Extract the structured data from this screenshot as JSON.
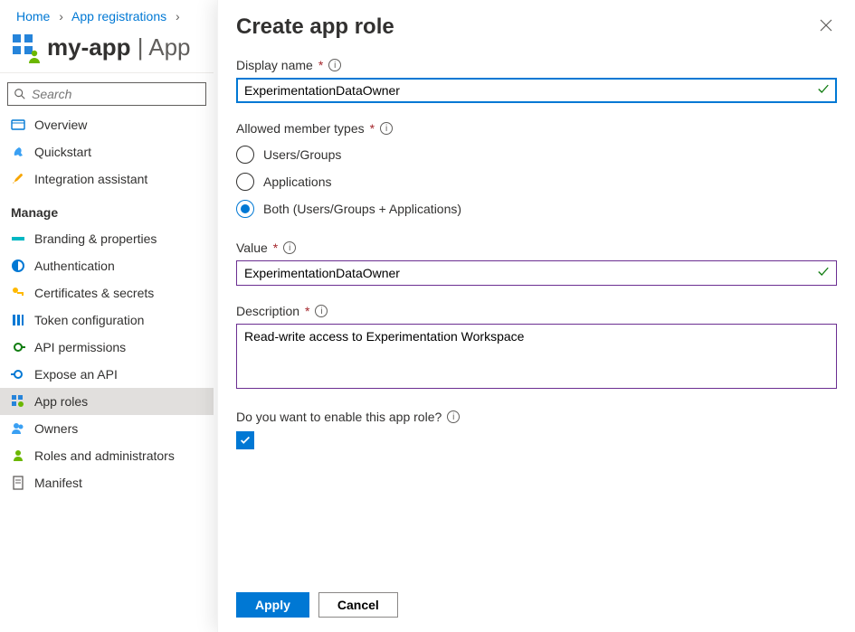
{
  "breadcrumb": {
    "home": "Home",
    "appreg": "App registrations"
  },
  "header": {
    "title_app": "my-app",
    "title_section": "App"
  },
  "search": {
    "placeholder": "Search"
  },
  "nav": {
    "overview": "Overview",
    "quickstart": "Quickstart",
    "integration": "Integration assistant",
    "group_manage": "Manage",
    "branding": "Branding & properties",
    "authn": "Authentication",
    "certs": "Certificates & secrets",
    "tokencfg": "Token configuration",
    "apiperm": "API permissions",
    "expose": "Expose an API",
    "approles": "App roles",
    "owners": "Owners",
    "rolesadmin": "Roles and administrators",
    "manifest": "Manifest"
  },
  "panel": {
    "title": "Create app role",
    "display_name_label": "Display name",
    "display_name_value": "ExperimentationDataOwner",
    "allowed_label": "Allowed member types",
    "allowed_options": {
      "users": "Users/Groups",
      "apps": "Applications",
      "both": "Both (Users/Groups + Applications)"
    },
    "allowed_selected": "both",
    "value_label": "Value",
    "value_value": "ExperimentationDataOwner",
    "desc_label": "Description",
    "desc_value": "Read-write access to Experimentation Workspace",
    "enable_label": "Do you want to enable this app role?",
    "enable_checked": true,
    "apply": "Apply",
    "cancel": "Cancel"
  }
}
